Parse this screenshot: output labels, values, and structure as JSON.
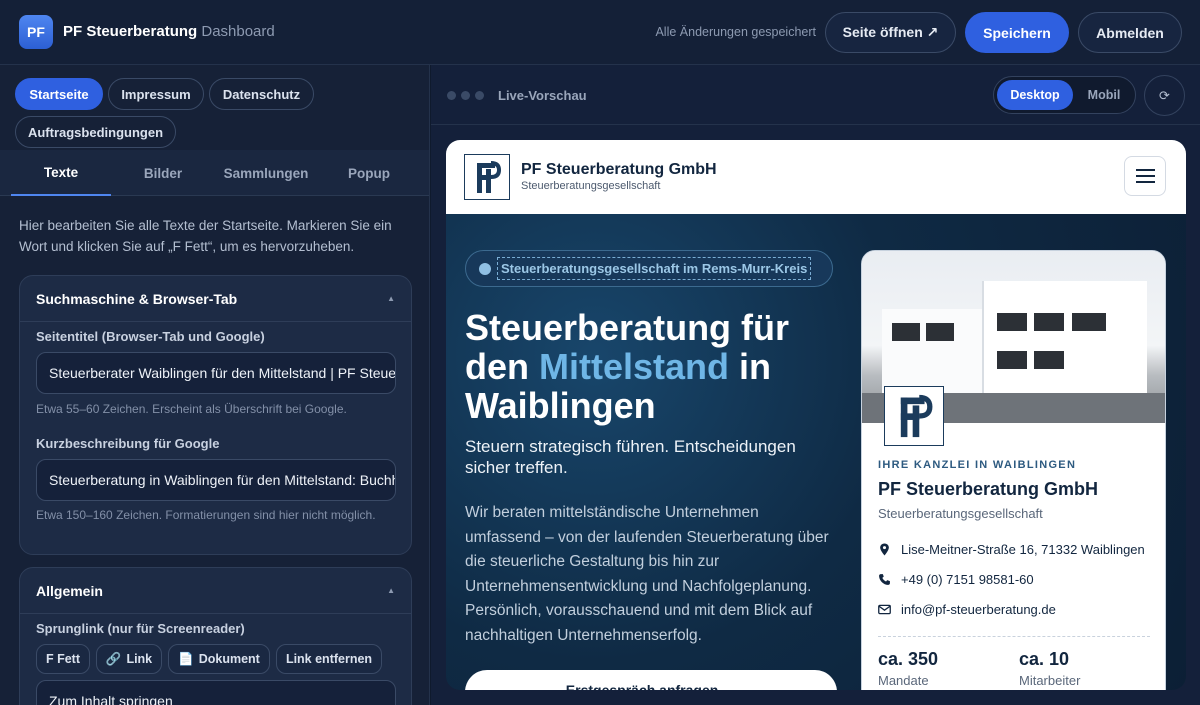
{
  "app": {
    "logo_text": "PF",
    "brand": "PF Steuerberatung",
    "brand_sub": "Dashboard",
    "saved_status": "Alle Änderungen gespeichert",
    "open_page_label": "Seite öffnen ↗",
    "save_label": "Speichern",
    "logout_label": "Abmelden"
  },
  "pages": [
    {
      "label": "Startseite",
      "active": true
    },
    {
      "label": "Impressum",
      "active": false
    },
    {
      "label": "Datenschutz",
      "active": false
    },
    {
      "label": "Auftragsbedingungen",
      "active": false
    }
  ],
  "subtabs": [
    {
      "label": "Texte",
      "active": true
    },
    {
      "label": "Bilder",
      "active": false
    },
    {
      "label": "Sammlungen",
      "active": false
    },
    {
      "label": "Popup",
      "active": false
    }
  ],
  "intro": "Hier bearbeiten Sie alle Texte der Startseite. Markieren Sie ein Wort und klicken Sie auf „F Fett“, um es hervorzuheben.",
  "seo_card": {
    "title": "Suchmaschine & Browser-Tab",
    "page_title_label": "Seitentitel (Browser-Tab und Google)",
    "page_title_value": "Steuerberater Waiblingen für den Mittelstand | PF Steuerberatung",
    "page_title_hint": "Etwa 55–60 Zeichen. Erscheint als Überschrift bei Google.",
    "desc_label": "Kurzbeschreibung für Google",
    "desc_value": "Steuerberatung in Waiblingen für den Mittelstand: Buchhaltung",
    "desc_hint": "Etwa 150–160 Zeichen. Formatierungen sind hier nicht möglich."
  },
  "general_card": {
    "title": "Allgemein",
    "skip_label": "Sprunglink (nur für Screenreader)",
    "fmt_bold": "F Fett",
    "fmt_link": "Link",
    "fmt_doc": "Dokument",
    "fmt_unlink": "Link entfernen",
    "skip_value": "Zum Inhalt springen"
  },
  "preview": {
    "label": "Live-Vorschau",
    "desktop": "Desktop",
    "mobile": "Mobil",
    "reload_icon": "⟳"
  },
  "site": {
    "name": "PF Steuerberatung GmbH",
    "sub": "Steuerberatungsgesellschaft",
    "badge": "Steuerberatungsgesellschaft im Rems-Murr-Kreis",
    "h1_part1": "Steuerberatung für den ",
    "h1_accent": "Mittelstand",
    "h1_part2": " in Waiblingen",
    "lead": "Steuern strategisch führen. Entscheidungen sicher treffen.",
    "body": "Wir beraten mittelständische Unternehmen umfassend – von der laufenden Steuerberatung über die steuerliche Gestaltung bis hin zur Unternehmensentwicklung und Nachfolgeplanung. Persönlich, vorausschauend und mit dem Blick auf nachhaltigen Unternehmenserfolg.",
    "cta": "Erstgespräch anfragen →"
  },
  "office": {
    "kicker": "IHRE KANZLEI IN WAIBLINGEN",
    "name": "PF Steuerberatung GmbH",
    "sub": "Steuerberatungsgesellschaft",
    "address": "Lise-Meitner-Straße 16, 71332 Waiblingen",
    "phone": "+49 (0) 7151 98581-60",
    "email": "info@pf-steuerberatung.de",
    "stat1_num": "ca. 350",
    "stat1_label": "Mandate",
    "stat2_num": "ca. 10",
    "stat2_label": "Mitarbeiter"
  },
  "colors": {
    "accent": "#2f60e0",
    "site_accent": "#6fb6e6",
    "site_navy": "#12263f"
  }
}
